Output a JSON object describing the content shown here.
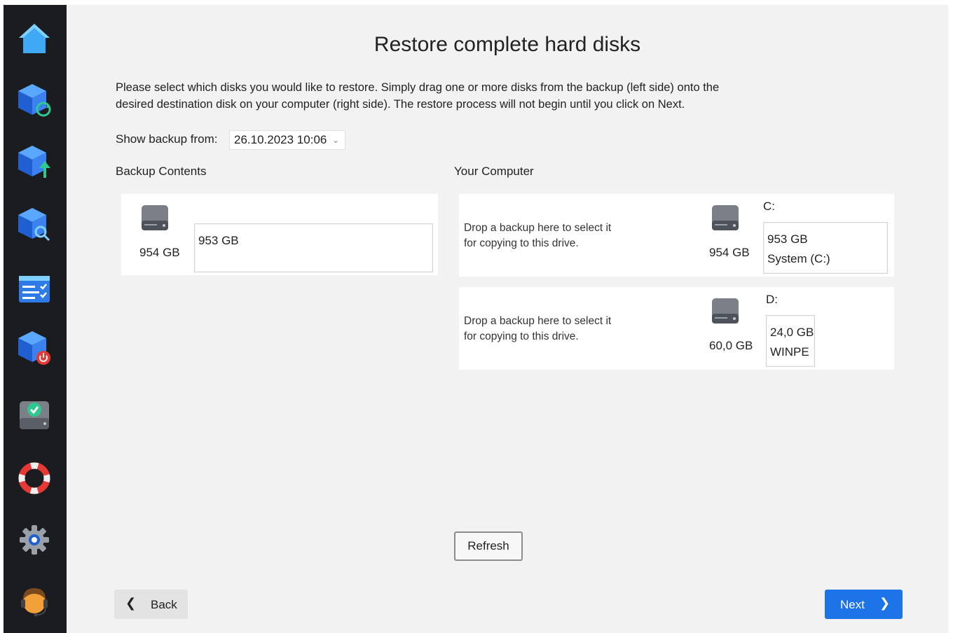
{
  "sidebar": {
    "items": [
      {
        "name": "home-icon"
      },
      {
        "name": "backup-refresh-icon"
      },
      {
        "name": "backup-upload-icon"
      },
      {
        "name": "backup-search-icon"
      },
      {
        "name": "task-list-icon"
      },
      {
        "name": "backup-power-icon"
      },
      {
        "name": "drive-check-icon"
      },
      {
        "name": "lifebuoy-icon"
      },
      {
        "name": "settings-gear-icon"
      },
      {
        "name": "support-agent-icon"
      }
    ]
  },
  "page": {
    "title": "Restore complete hard disks",
    "intro_line1": "Please select which disks you would like to restore. Simply drag one or more disks from the backup (left side) onto the",
    "intro_line2": "desired destination disk on your computer (right side). The restore process will not begin until you click on Next."
  },
  "backup_selector": {
    "label": "Show backup from:",
    "selected": "26.10.2023 10:06"
  },
  "backup_contents": {
    "heading": "Backup Contents",
    "disk": {
      "size": "954 GB",
      "partition_size": "953 GB"
    }
  },
  "your_computer": {
    "heading": "Your Computer",
    "drives": [
      {
        "drop_line1": "Drop a backup here to select it",
        "drop_line2": "for copying to this drive.",
        "disk_size": "954 GB",
        "letter": "C:",
        "partition_size": "953 GB",
        "partition_label": "System (C:)"
      },
      {
        "drop_line1": "Drop a backup here to select it",
        "drop_line2": "for copying to this drive.",
        "disk_size": "60,0 GB",
        "letter": "D:",
        "partition_size": "24,0 GB",
        "partition_label": "WINPE"
      }
    ]
  },
  "buttons": {
    "refresh": "Refresh",
    "back": "Back",
    "next": "Next"
  },
  "colors": {
    "sidebar_bg": "#1b1c1f",
    "content_bg": "#f2f2f2",
    "accent": "#1d74e8"
  }
}
